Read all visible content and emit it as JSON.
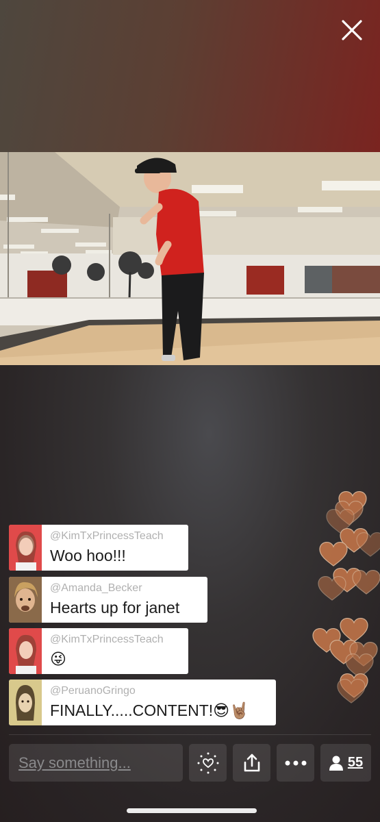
{
  "stream": {
    "close_icon": "close-icon"
  },
  "chat": {
    "messages": [
      {
        "handle": "@KimTxPrincessTeach",
        "text": "Woo hoo!!!",
        "avatar_color": "#e04a4a"
      },
      {
        "handle": "@Amanda_Becker",
        "text": "Hearts up for janet",
        "avatar_color": "#8a6a4a"
      },
      {
        "handle": "@KimTxPrincessTeach",
        "text": "😜",
        "avatar_color": "#e04a4a"
      },
      {
        "handle": "@PeruanoGringo",
        "text": "FINALLY.....CONTENT!😎🤘🏽",
        "avatar_color": "#d8c98c"
      }
    ]
  },
  "composer": {
    "placeholder": "Say something..."
  },
  "toolbar": {
    "heart_icon": "heart-sparkle-icon",
    "share_icon": "share-icon",
    "more_icon": "more-icon",
    "viewers_icon": "person-icon",
    "viewers_count": "55"
  },
  "colors": {
    "heart": "#c9784a",
    "chat_bg": "#ffffff",
    "handle": "#b0b0b0"
  }
}
